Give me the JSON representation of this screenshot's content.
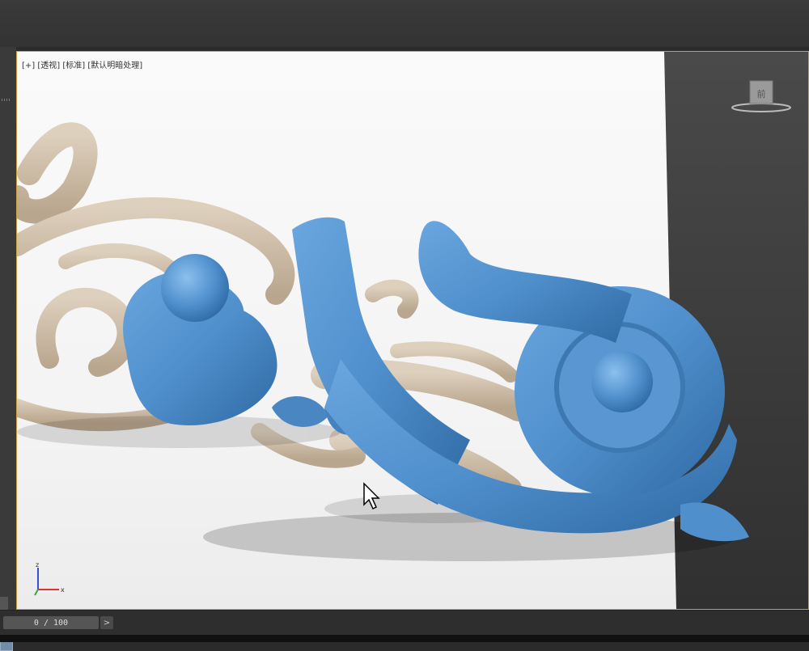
{
  "viewport": {
    "label": "[+] [透视] [标准] [默认明暗处理]",
    "viewcube_face": "前"
  },
  "timeline": {
    "frame_display": "0 / 100",
    "next_glyph": ">"
  },
  "axes": {
    "x": "x",
    "z": "z"
  },
  "colors": {
    "model_blue": "#4f8fcc",
    "wood": "#cdbda8",
    "viewport_border": "#c9a13b"
  },
  "icons": [
    "viewcube-icon",
    "mouse-cursor-icon",
    "axis-tripod-icon"
  ]
}
